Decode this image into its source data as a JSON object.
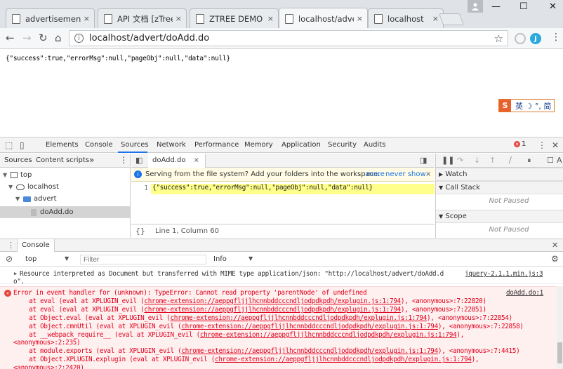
{
  "browser": {
    "tabs": [
      {
        "label": "advertisement.h"
      },
      {
        "label": "API 文档 [zTree -"
      },
      {
        "label": "ZTREE DEMO"
      },
      {
        "label": "localhost/advert"
      },
      {
        "label": "localhost"
      }
    ],
    "close_glyph": "×",
    "url": "localhost/advert/doAdd.do",
    "window_controls": {
      "minimize": "—",
      "maximize": "☐",
      "close": "✕"
    },
    "extension_label": "J",
    "profile_icon": "person-icon"
  },
  "page": {
    "body_text": "{\"success\":true,\"errorMsg\":null,\"pageObj\":null,\"data\":null}",
    "ime": {
      "logo": "S",
      "text": "英 ☽ °, 简"
    }
  },
  "devtools": {
    "tabs": [
      "Elements",
      "Console",
      "Sources",
      "Network",
      "Performance",
      "Memory",
      "Application",
      "Security",
      "Audits"
    ],
    "active_tab": "Sources",
    "error_count": "1",
    "navigator": {
      "tabs": [
        "Sources",
        "Content scripts"
      ],
      "more": "»",
      "tree": [
        {
          "label": "top"
        },
        {
          "label": "localhost"
        },
        {
          "label": "advert"
        },
        {
          "label": "doAdd.do"
        }
      ]
    },
    "editor": {
      "file_tab": "doAdd.do",
      "infobar_text": "Serving from the file system? Add your folders into the workspace.",
      "infobar_more": "more",
      "infobar_never": "never show",
      "line_number": "1",
      "code": "{\"success\":true,\"errorMsg\":null,\"pageObj\":null,\"data\":null}",
      "status": "Line 1, Column 60",
      "status_braces": "{}"
    },
    "debugger": {
      "sections": [
        "Watch",
        "Call Stack",
        "Scope"
      ],
      "not_paused": "Not Paused",
      "pause_label": "A"
    },
    "drawer": {
      "tab": "Console",
      "context": "top",
      "filter_placeholder": "Filter",
      "levels": "Info"
    },
    "console": {
      "info_message": "Resource interpreted as Document but transferred with MIME type application/json: \"http://localhost/advert/doAdd.d",
      "info_message_cont": "o\".",
      "info_source": "jquery-2.1.1.min.js:3",
      "error": {
        "source": "doAdd.do:1",
        "lines": [
          {
            "pre": "Error in event handler for (unknown): TypeError: Cannot read property 'parentNode' of undefined",
            "link": "",
            "post": ""
          },
          {
            "pre": "    at eval (eval at XPLUGIN_evil (",
            "link": "chrome-extension://aeppgfljjlhcnnbddcccndljodpdkpdh/explugin.js:1:794",
            "post": "), <anonymous>:7:22820)"
          },
          {
            "pre": "    at eval (eval at XPLUGIN_evil (",
            "link": "chrome-extension://aeppgfljjlhcnnbddcccndljodpdkpdh/explugin.js:1:794",
            "post": "), <anonymous>:7:22851)"
          },
          {
            "pre": "    at Object.eval (eval at XPLUGIN_evil (",
            "link": "chrome-extension://aeppgfljjlhcnnbddcccndljodpdkpdh/explugin.js:1:794",
            "post": "), <anonymous>:7:22854)"
          },
          {
            "pre": "    at Object.cmnUtil (eval at XPLUGIN_evil (",
            "link": "chrome-extension://aeppgfljjlhcnnbddcccndljodpdkpdh/explugin.js:1:794",
            "post": "), <anonymous>:7:22858)"
          },
          {
            "pre": "    at __webpack_require__ (eval at XPLUGIN_evil (",
            "link": "chrome-extension://aeppgfljjlhcnnbddcccndljodpdkpdh/explugin.js:1:794",
            "post": "),"
          },
          {
            "pre": "<anonymous>:2:235)",
            "link": "",
            "post": ""
          },
          {
            "pre": "    at module.exports (eval at XPLUGIN_evil (",
            "link": "chrome-extension://aeppgfljjlhcnnbddcccndljodpdkpdh/explugin.js:1:794",
            "post": "), <anonymous>:7:4415)"
          },
          {
            "pre": "    at Object.XPLUGIN.explugin (eval at XPLUGIN_evil (",
            "link": "chrome-extension://aeppgfljjlhcnnbddcccndljodpdkpdh/explugin.js:1:794",
            "post": "),"
          },
          {
            "pre": "<anonymous>:2:2420)",
            "link": "",
            "post": ""
          }
        ]
      }
    }
  },
  "colors": {
    "accent": "#1a73e8",
    "error_red": "#e0001b",
    "error_bg": "#fff0f0",
    "highlight_line": "#ffff8c",
    "ime_orange": "#e8612c"
  }
}
